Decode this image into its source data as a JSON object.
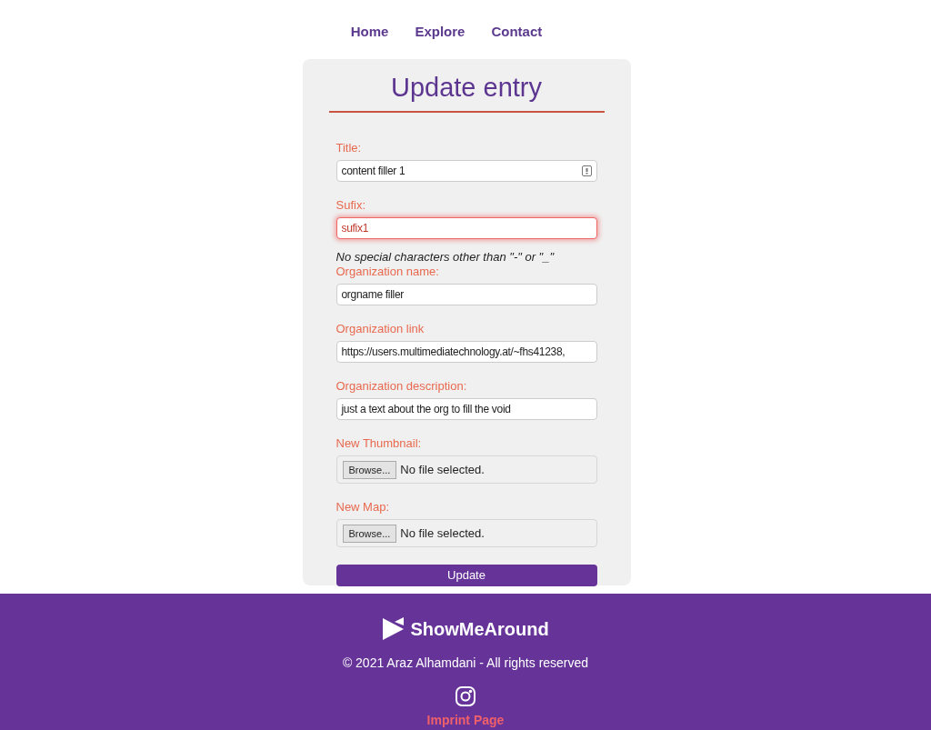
{
  "nav": {
    "links": [
      "Home",
      "Explore",
      "Contact"
    ]
  },
  "form": {
    "title": "Update entry",
    "fields": [
      {
        "kind": "text",
        "label": "Title:",
        "value": "content filler 1",
        "invalid": false
      },
      {
        "kind": "text",
        "label": "Sufix:",
        "value": "sufix1",
        "invalid": true,
        "hint": "No special characters other than \"-\" or \"_\""
      },
      {
        "kind": "text",
        "label": "Organization name:",
        "value": "orgname filler",
        "invalid": false
      },
      {
        "kind": "text",
        "label": "Organization link",
        "value": "https://users.multimediatechnology.at/~fhs41238,",
        "invalid": false
      },
      {
        "kind": "text",
        "label": "Organization description:",
        "value": "just a text about the org to fill the void",
        "invalid": false
      },
      {
        "kind": "file",
        "label": "New Thumbnail:",
        "button": "Browse...",
        "status": "No file selected."
      },
      {
        "kind": "file",
        "label": "New Map:",
        "button": "Browse...",
        "status": "No file selected."
      }
    ],
    "submit": "Update"
  },
  "footer": {
    "brand": "ShowMeAround",
    "copyright": "© 2021 Araz Alhamdani - All rights reserved",
    "link": "Imprint Page"
  }
}
